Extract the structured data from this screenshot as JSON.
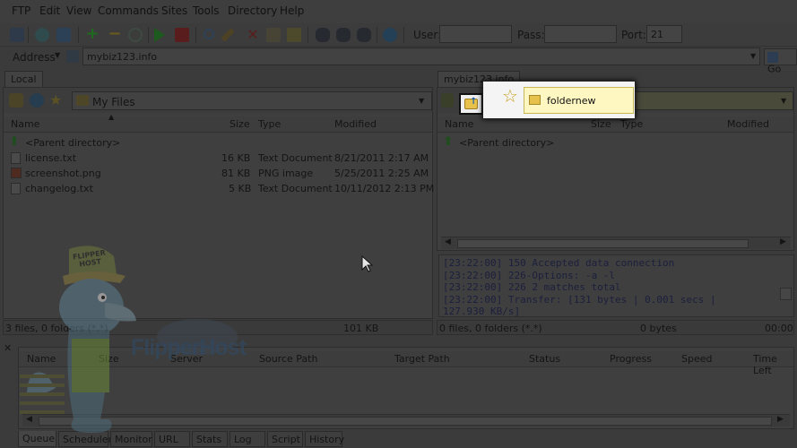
{
  "menu": [
    "FTP",
    "Edit",
    "View",
    "Commands",
    "Sites",
    "Tools",
    "Directory",
    "Help"
  ],
  "toolbar": {
    "user_label": "User:",
    "user_value": "",
    "pass_label": "Pass:",
    "pass_value": "",
    "port_label": "Port:",
    "port_value": "21"
  },
  "address": {
    "label": "Address",
    "value": "mybiz123.info",
    "go_label": "Go"
  },
  "local": {
    "tab": "Local",
    "folder": "My Files",
    "columns": [
      "Name",
      "Size",
      "Type",
      "Modified"
    ],
    "parent": "<Parent directory>",
    "files": [
      {
        "name": "license.txt",
        "size": "16 KB",
        "type": "Text Document",
        "modified": "8/21/2011 2:17 AM"
      },
      {
        "name": "screenshot.png",
        "size": "81 KB",
        "type": "PNG image",
        "modified": "5/25/2011 2:25 AM"
      },
      {
        "name": "changelog.txt",
        "size": "5 KB",
        "type": "Text Document",
        "modified": "10/11/2012 2:13 PM"
      }
    ],
    "status_left": "3 files, 0 folders (*.*)",
    "status_right": "101 KB"
  },
  "remote": {
    "tab": "mybiz123.info",
    "folder": "foldernew",
    "columns": [
      "Name",
      "Size",
      "Type",
      "Modified"
    ],
    "parent": "<Parent directory>",
    "log": [
      "[23:22:00] 150 Accepted data connection",
      "[23:22:00] 226-Options: -a -l",
      "[23:22:00] 226 2 matches total",
      "[23:22:00] Transfer: [131 bytes | 0.001 secs |",
      "127.930 KB/s]"
    ],
    "status_left": "0 files, 0 folders (*.*)",
    "status_mid": "0 bytes",
    "status_right": "00:00"
  },
  "queue": {
    "columns": [
      "Name",
      "Size",
      "Server",
      "Source Path",
      "Target Path",
      "Status",
      "Progress",
      "Speed",
      "Time Left"
    ],
    "tabs": [
      "Queue",
      "Scheduler",
      "Monitor",
      "URL",
      "Stats",
      "Log",
      "Script",
      "History"
    ]
  },
  "watermark": {
    "brand": "FlipperHost",
    "cap_text": "FLIPPER HOST"
  }
}
